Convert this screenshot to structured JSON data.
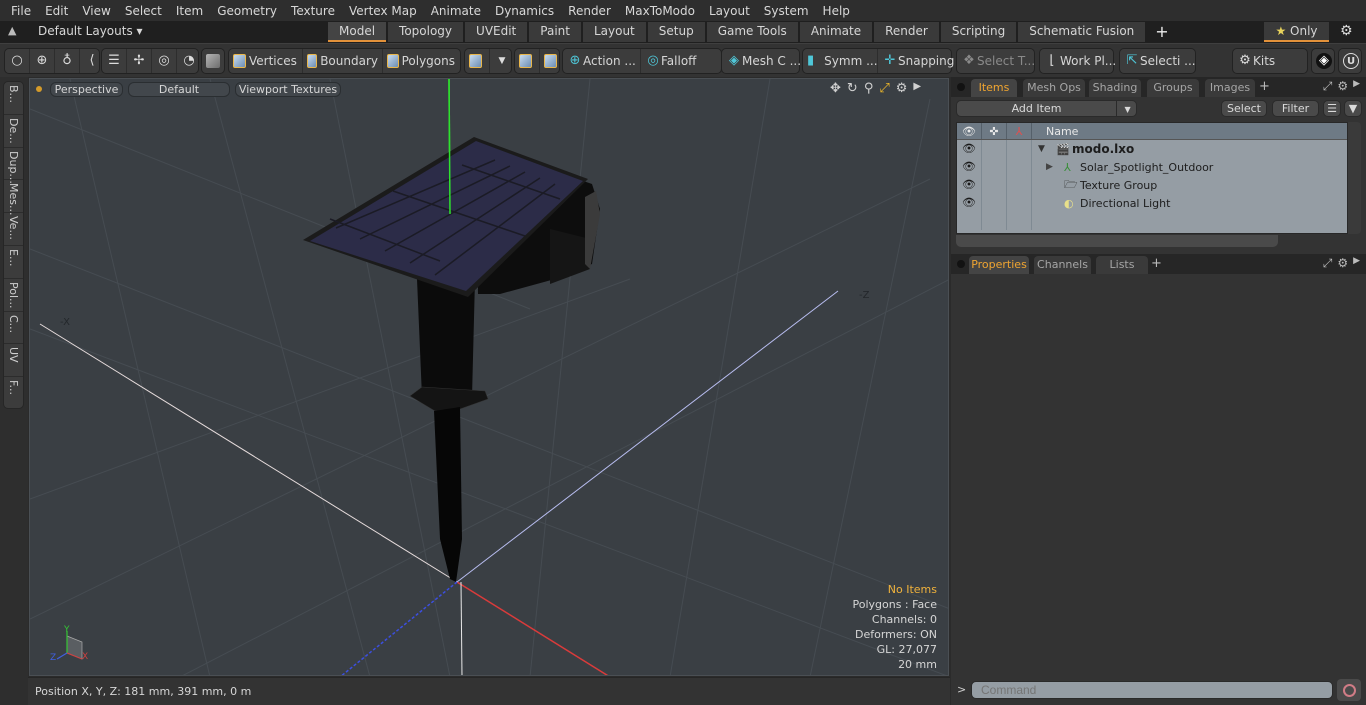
{
  "menu": [
    "File",
    "Edit",
    "View",
    "Select",
    "Item",
    "Geometry",
    "Texture",
    "Vertex Map",
    "Animate",
    "Dynamics",
    "Render",
    "MaxToModo",
    "Layout",
    "System",
    "Help"
  ],
  "layoutbar": {
    "layout_selector": "Default Layouts ▾",
    "tabs": [
      "Model",
      "Topology",
      "UVEdit",
      "Paint",
      "Layout",
      "Setup",
      "Game Tools",
      "Animate",
      "Render",
      "Scripting",
      "Schematic Fusion"
    ],
    "active_tab": "Model",
    "add_tab": "+",
    "only_label": "Only",
    "star": "★"
  },
  "toolbar": {
    "vertices": "Vertices",
    "boundary": "Boundary",
    "polygons": "Polygons",
    "action": "Action  ...",
    "falloff": "Falloff",
    "mesh_c": "Mesh C ...",
    "symm": "Symm ...",
    "snapping": "Snapping",
    "select_t": "Select T...",
    "work_pl": "Work Pl...",
    "selecti": "Selecti ...",
    "kits": "Kits"
  },
  "left_tabs": [
    "B...",
    "De...",
    "Dup...",
    "Mes...",
    "Ve...",
    "E...",
    "Pol...",
    "C...",
    "UV",
    "F..."
  ],
  "viewport": {
    "view_mode": "Perspective",
    "shading": "Default",
    "textures": "Viewport Textures",
    "axis_labels": {
      "neg_x": "-X",
      "neg_z": "-Z"
    },
    "info": {
      "selection": "No Items",
      "polygons": "Polygons : Face",
      "channels": "Channels: 0",
      "deformers": "Deformers: ON",
      "gl": "GL: 27,077",
      "scale": "20 mm"
    },
    "gizmo": {
      "y": "Y",
      "x": "X",
      "z": "Z"
    }
  },
  "status": {
    "position": "Position X, Y, Z:   181 mm, 391 mm, 0 m"
  },
  "items_panel": {
    "tabs": [
      "Items",
      "Mesh Ops",
      "Shading",
      "Groups",
      "Images"
    ],
    "active_tab": "Items",
    "add_item": "Add Item",
    "select": "Select",
    "filter": "Filter",
    "name_header": "Name",
    "tree": [
      {
        "label": "modo.lxo",
        "level": 0,
        "expander": "▼",
        "icon": "scene-icon",
        "bold": true
      },
      {
        "label": "Solar_Spotlight_Outdoor",
        "level": 1,
        "expander": "▶",
        "icon": "locator-icon",
        "bold": false
      },
      {
        "label": "Texture Group",
        "level": 1,
        "expander": "",
        "icon": "folder-icon",
        "bold": false
      },
      {
        "label": "Directional Light",
        "level": 1,
        "expander": "",
        "icon": "light-icon",
        "bold": false
      }
    ]
  },
  "properties_panel": {
    "tabs": [
      "Properties",
      "Channels",
      "Lists"
    ],
    "active_tab": "Properties"
  },
  "command": {
    "prompt": ">",
    "placeholder": "Command"
  }
}
